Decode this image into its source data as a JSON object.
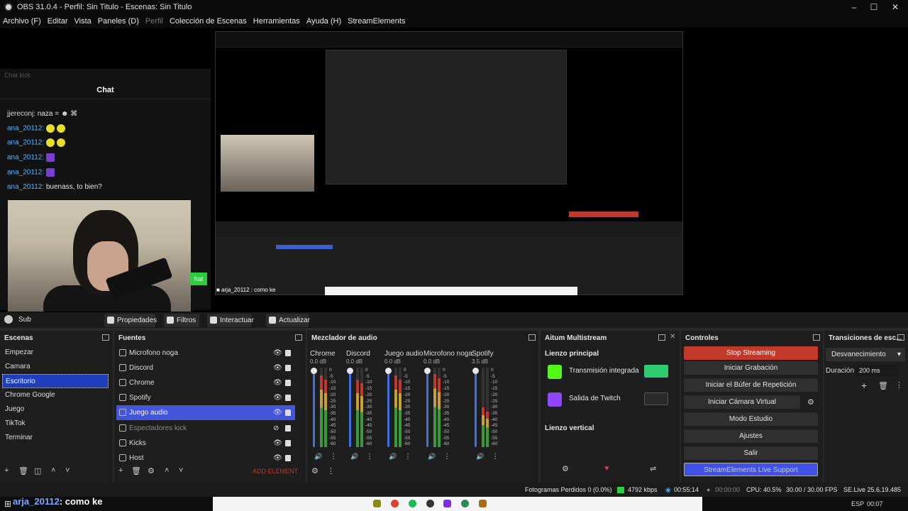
{
  "window": {
    "title": "OBS 31.0.4 - Perfil: Sin Titulo - Escenas: Sin Titulo"
  },
  "menu": [
    "Archivo (F)",
    "Editar",
    "Vista",
    "Paneles (D)",
    "Perfil",
    "Colección de Escenas",
    "Herramientas",
    "Ayuda (H)",
    "StreamElements"
  ],
  "chat": {
    "dock_label": "Chat kick",
    "header": "Chat",
    "messages": [
      {
        "user": "jjereconj:",
        "text": "naza = ☻ ⌘"
      },
      {
        "user": "ana_20112:",
        "text": ""
      },
      {
        "user": "ana_20112:",
        "text": ""
      },
      {
        "user": "ana_20112:",
        "text": ""
      },
      {
        "user": "ana_20112:",
        "text": ""
      },
      {
        "user": "ana_20112:",
        "text": "buenass, to bien?"
      }
    ],
    "chat_button": "hat"
  },
  "overlay": {
    "user": "arja_20112",
    "text": ": como ke"
  },
  "preview_overlay_text": "■ arja_20112 : como ke",
  "source_bar": {
    "current_source": "Sub",
    "buttons": [
      "Propiedades",
      "Filtros",
      "Interactuar",
      "Actualizar"
    ]
  },
  "scenes": {
    "title": "Escenas",
    "items": [
      "Empezar",
      "Camara",
      "Escritorio",
      "Chrome Google",
      "Juego",
      "TikTok",
      "Terminar"
    ],
    "selected": "Escritorio"
  },
  "sources": {
    "title": "Fuentes",
    "items": [
      "Microfono noga",
      "Discord",
      "Chrome",
      "Spotify",
      "Juego audio",
      "Espectadores kick",
      "Kicks",
      "Host"
    ],
    "selected": "Juego audio",
    "add_element": "ADD ELEMENT"
  },
  "mixer": {
    "title": "Mezclador de audio",
    "channels": [
      {
        "name": "Chrome",
        "db": "0.0 dB",
        "level": 0.9
      },
      {
        "name": "Discord",
        "db": "0.0 dB",
        "level": 0.85
      },
      {
        "name": "Juego audio",
        "db": "0.0 dB",
        "level": 0.9
      },
      {
        "name": "Microfono noga",
        "db": "0.0 dB",
        "level": 0.92
      },
      {
        "name": "Spotify",
        "db": "3.5 dB",
        "level": 0.5
      }
    ],
    "scale": [
      "0",
      "-5",
      "-10",
      "-15",
      "-20",
      "-25",
      "-30",
      "-35",
      "-40",
      "-45",
      "-50",
      "-55",
      "-60"
    ]
  },
  "multistream": {
    "title": "Aitum Multistream",
    "main_canvas": "Lienzo principal",
    "outputs": [
      {
        "label": "Transmisión integrada",
        "active": true
      },
      {
        "label": "Salida de Twitch",
        "active": false
      }
    ],
    "vertical_canvas": "Lienzo vertical"
  },
  "controls": {
    "title": "Controles",
    "buttons": [
      "Stop Streaming",
      "Iniciar Grabación",
      "Iniciar el Búfer de Repetición",
      "Iniciar Cámara Virtual",
      "Modo Estudio",
      "Ajustes",
      "Salir"
    ],
    "support": "StreamElements Live Support"
  },
  "transitions": {
    "title": "Transiciones de esc...",
    "selected": "Desvanecimiento",
    "duration_label": "Duración",
    "duration_value": "200 ms"
  },
  "statusbar": {
    "dropped": "Fotogramas Perdidos 0 (0.0%)",
    "bitrate": "4792 kbps",
    "stream_time": "00:55:14",
    "rec_time": "00:00:00",
    "cpu": "CPU: 40.5%",
    "fps": "30.00 / 30.00 FPS",
    "version": "SE.Live 25.6.19.485"
  },
  "taskbar": {
    "lang": "ESP",
    "time": "00:07"
  },
  "colors": {
    "accent": "#4355d9",
    "stop": "#c0392b",
    "kick": "#53fc18",
    "twitch": "#9146ff"
  }
}
